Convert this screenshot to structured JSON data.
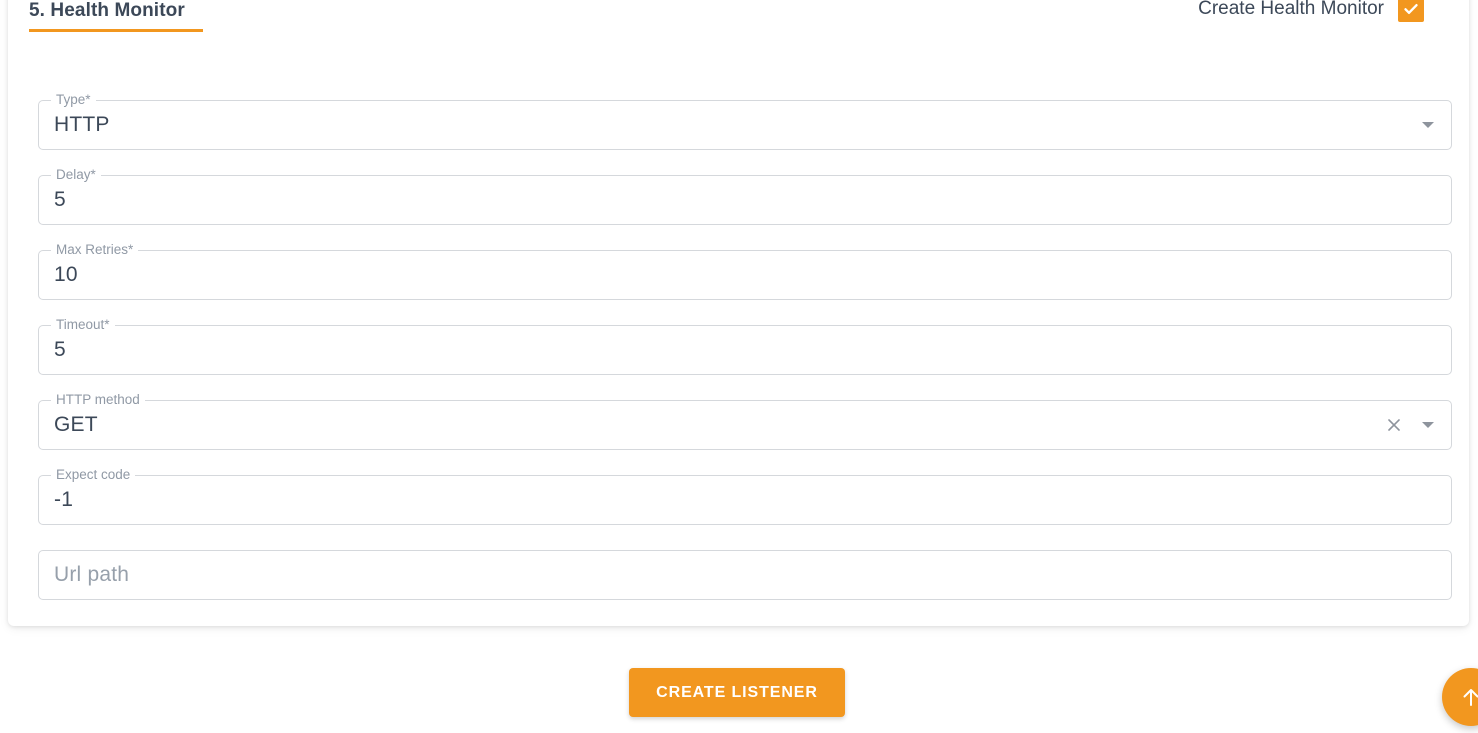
{
  "section": {
    "title": "5. Health Monitor",
    "accent_color": "#f2971f",
    "toggle": {
      "label": "Create Health Monitor",
      "checked": true,
      "icon": "checkmark-icon"
    }
  },
  "form": {
    "fields": [
      {
        "name": "type",
        "label": "Type*",
        "value": "HTTP",
        "placeholder": "",
        "control": "select",
        "icons": [
          "chevron-down-icon"
        ]
      },
      {
        "name": "delay",
        "label": "Delay*",
        "value": "5",
        "placeholder": "",
        "control": "text",
        "icons": []
      },
      {
        "name": "max-retries",
        "label": "Max Retries*",
        "value": "10",
        "placeholder": "",
        "control": "text",
        "icons": []
      },
      {
        "name": "timeout",
        "label": "Timeout*",
        "value": "5",
        "placeholder": "",
        "control": "text",
        "icons": []
      },
      {
        "name": "http-method",
        "label": "HTTP method",
        "value": "GET",
        "placeholder": "",
        "control": "select",
        "icons": [
          "close-icon",
          "chevron-down-icon"
        ]
      },
      {
        "name": "expect-code",
        "label": "Expect code",
        "value": "-1",
        "placeholder": "",
        "control": "text",
        "icons": []
      },
      {
        "name": "url-path",
        "label": "",
        "value": "",
        "placeholder": "Url path",
        "control": "text",
        "icons": []
      }
    ]
  },
  "footer": {
    "submit_label": "CREATE LISTENER",
    "scroll_top_icon": "arrow-up-icon"
  },
  "colors": {
    "accent": "#f2971f",
    "text": "#3c4858",
    "label": "#9099a5",
    "border": "#d5d8dc"
  }
}
